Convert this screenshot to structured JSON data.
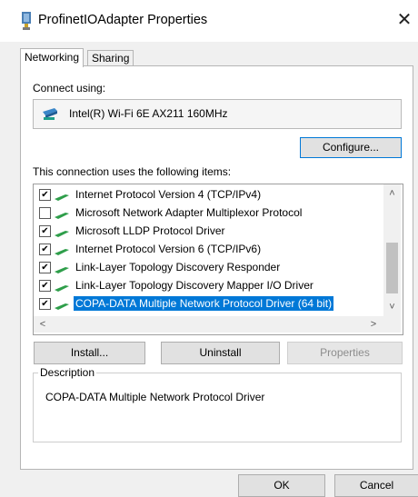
{
  "window": {
    "title": "ProfinetIOAdapter Properties",
    "close_glyph": "✕"
  },
  "tabs": [
    {
      "label": "Networking",
      "active": true
    },
    {
      "label": "Sharing",
      "active": false
    }
  ],
  "connect": {
    "label": "Connect using:",
    "adapter_name": "Intel(R) Wi-Fi 6E AX211 160MHz",
    "adapter_icon": "network-adapter-icon"
  },
  "configure_label": "Configure...",
  "items_label": "This connection uses the following items:",
  "items": [
    {
      "checked": true,
      "label": "Internet Protocol Version 4 (TCP/IPv4)",
      "selected": false
    },
    {
      "checked": false,
      "label": "Microsoft Network Adapter Multiplexor Protocol",
      "selected": false
    },
    {
      "checked": true,
      "label": "Microsoft LLDP Protocol Driver",
      "selected": false
    },
    {
      "checked": true,
      "label": "Internet Protocol Version 6 (TCP/IPv6)",
      "selected": false
    },
    {
      "checked": true,
      "label": "Link-Layer Topology Discovery Responder",
      "selected": false
    },
    {
      "checked": true,
      "label": "Link-Layer Topology Discovery Mapper I/O Driver",
      "selected": false
    },
    {
      "checked": true,
      "label": "COPA-DATA Multiple Network Protocol Driver (64 bit)",
      "selected": true
    }
  ],
  "scroll": {
    "up": "˄",
    "down": "˅",
    "left": "<",
    "right": ">"
  },
  "buttons": {
    "install": "Install...",
    "uninstall": "Uninstall",
    "properties": "Properties",
    "ok": "OK",
    "cancel": "Cancel"
  },
  "description": {
    "legend": "Description",
    "text": "COPA-DATA Multiple Network Protocol Driver"
  },
  "colors": {
    "selection": "#0078d7",
    "dialog_bg": "#f0f0f0",
    "protocol_icon": "#2e9e4a"
  },
  "check_glyph": "✔"
}
